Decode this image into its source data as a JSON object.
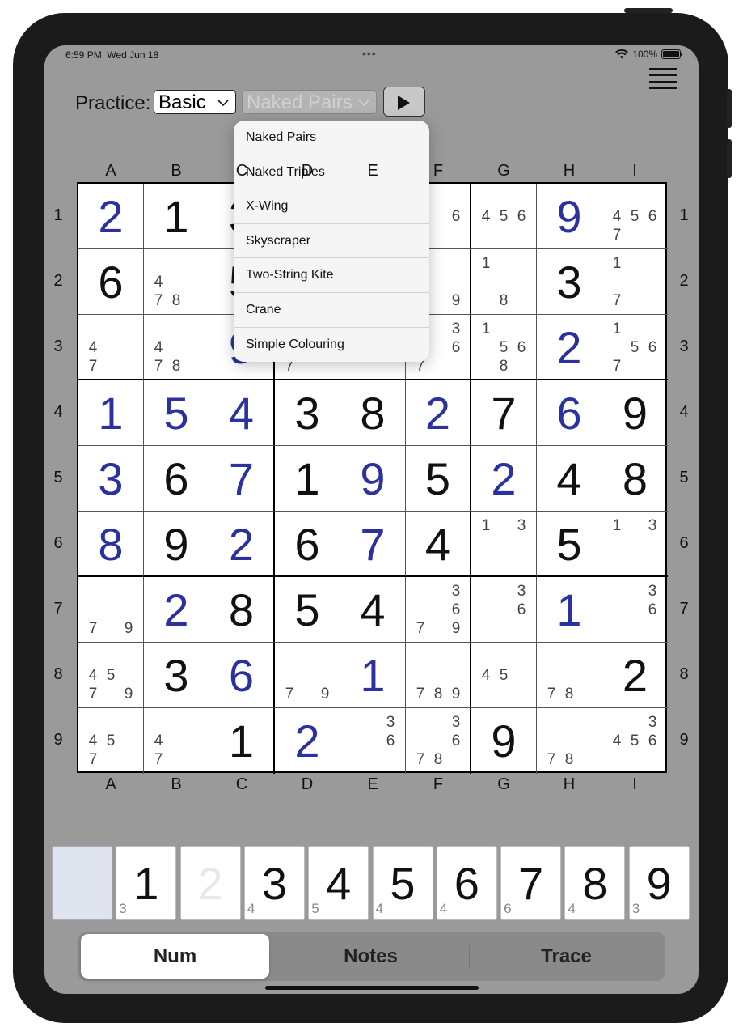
{
  "status_bar": {
    "time": "6:59 PM",
    "date": "Wed Jun 18",
    "battery": "100%",
    "dots": "•••"
  },
  "toolbar": {
    "practice_label": "Practice:",
    "level_select": "Basic",
    "technique_select": "Naked Pairs"
  },
  "technique_menu": [
    "Naked Pairs",
    "Naked Triples",
    "X-Wing",
    "Skyscraper",
    "Two-String Kite",
    "Crane",
    "Simple Colouring"
  ],
  "columns": [
    "A",
    "B",
    "C",
    "D",
    "E",
    "F",
    "G",
    "H",
    "I"
  ],
  "rows": [
    "1",
    "2",
    "3",
    "4",
    "5",
    "6",
    "7",
    "8",
    "9"
  ],
  "grid": [
    [
      {
        "v": "2",
        "s": "solved"
      },
      {
        "v": "1",
        "s": "given"
      },
      {
        "v": "3",
        "s": "given"
      },
      {
        "n": []
      },
      {
        "n": []
      },
      {
        "n": [
          6
        ]
      },
      {
        "n": [
          4,
          5,
          6
        ]
      },
      {
        "v": "9",
        "s": "solved"
      },
      {
        "n": [
          4,
          5,
          6,
          7
        ]
      }
    ],
    [
      {
        "v": "6",
        "s": "given"
      },
      {
        "n": [
          4,
          7,
          8
        ]
      },
      {
        "v": "5",
        "s": "given"
      },
      {
        "n": []
      },
      {
        "n": []
      },
      {
        "n": [
          9
        ]
      },
      {
        "n": [
          1,
          8
        ]
      },
      {
        "v": "3",
        "s": "given"
      },
      {
        "n": [
          1,
          7
        ]
      }
    ],
    [
      {
        "n": [
          4,
          7
        ]
      },
      {
        "n": [
          4,
          7,
          8
        ]
      },
      {
        "v": "9",
        "s": "solved"
      },
      {
        "n": [
          7
        ]
      },
      {
        "n": []
      },
      {
        "n": [
          3,
          6,
          7
        ]
      },
      {
        "n": [
          1,
          5,
          6,
          8
        ]
      },
      {
        "v": "2",
        "s": "solved"
      },
      {
        "n": [
          1,
          5,
          6,
          7
        ]
      }
    ],
    [
      {
        "v": "1",
        "s": "solved"
      },
      {
        "v": "5",
        "s": "solved"
      },
      {
        "v": "4",
        "s": "solved"
      },
      {
        "v": "3",
        "s": "given"
      },
      {
        "v": "8",
        "s": "given"
      },
      {
        "v": "2",
        "s": "solved"
      },
      {
        "v": "7",
        "s": "given"
      },
      {
        "v": "6",
        "s": "solved"
      },
      {
        "v": "9",
        "s": "given"
      }
    ],
    [
      {
        "v": "3",
        "s": "solved"
      },
      {
        "v": "6",
        "s": "given"
      },
      {
        "v": "7",
        "s": "solved"
      },
      {
        "v": "1",
        "s": "given"
      },
      {
        "v": "9",
        "s": "solved"
      },
      {
        "v": "5",
        "s": "given"
      },
      {
        "v": "2",
        "s": "solved"
      },
      {
        "v": "4",
        "s": "given"
      },
      {
        "v": "8",
        "s": "given"
      }
    ],
    [
      {
        "v": "8",
        "s": "solved"
      },
      {
        "v": "9",
        "s": "given"
      },
      {
        "v": "2",
        "s": "solved"
      },
      {
        "v": "6",
        "s": "given"
      },
      {
        "v": "7",
        "s": "solved"
      },
      {
        "v": "4",
        "s": "given"
      },
      {
        "n": [
          1,
          3
        ]
      },
      {
        "v": "5",
        "s": "given"
      },
      {
        "n": [
          1,
          3
        ]
      }
    ],
    [
      {
        "n": [
          7,
          9
        ]
      },
      {
        "v": "2",
        "s": "solved"
      },
      {
        "v": "8",
        "s": "given"
      },
      {
        "v": "5",
        "s": "given"
      },
      {
        "v": "4",
        "s": "given"
      },
      {
        "n": [
          3,
          6,
          7,
          9
        ]
      },
      {
        "n": [
          3,
          6
        ]
      },
      {
        "v": "1",
        "s": "solved"
      },
      {
        "n": [
          3,
          6
        ]
      }
    ],
    [
      {
        "n": [
          4,
          5,
          7,
          9
        ]
      },
      {
        "v": "3",
        "s": "given"
      },
      {
        "v": "6",
        "s": "solved"
      },
      {
        "n": [
          7,
          9
        ]
      },
      {
        "v": "1",
        "s": "solved"
      },
      {
        "n": [
          7,
          8,
          9
        ]
      },
      {
        "n": [
          4,
          5
        ]
      },
      {
        "n": [
          7,
          8
        ]
      },
      {
        "v": "2",
        "s": "given"
      }
    ],
    [
      {
        "n": [
          4,
          5,
          7
        ]
      },
      {
        "n": [
          4,
          7
        ]
      },
      {
        "v": "1",
        "s": "given"
      },
      {
        "v": "2",
        "s": "solved"
      },
      {
        "n": [
          3,
          6
        ]
      },
      {
        "n": [
          3,
          6,
          7,
          8
        ]
      },
      {
        "v": "9",
        "s": "given"
      },
      {
        "n": [
          7,
          8
        ]
      },
      {
        "n": [
          3,
          4,
          5,
          6
        ]
      }
    ]
  ],
  "numpad": [
    {
      "digit": "",
      "count": "",
      "state": "blank"
    },
    {
      "digit": "1",
      "count": "3",
      "state": "normal"
    },
    {
      "digit": "2",
      "count": "",
      "state": "done"
    },
    {
      "digit": "3",
      "count": "4",
      "state": "normal"
    },
    {
      "digit": "4",
      "count": "5",
      "state": "normal"
    },
    {
      "digit": "5",
      "count": "4",
      "state": "normal"
    },
    {
      "digit": "6",
      "count": "4",
      "state": "normal"
    },
    {
      "digit": "7",
      "count": "6",
      "state": "normal"
    },
    {
      "digit": "8",
      "count": "4",
      "state": "normal"
    },
    {
      "digit": "9",
      "count": "3",
      "state": "normal"
    }
  ],
  "modes": [
    {
      "label": "Num",
      "active": true
    },
    {
      "label": "Notes",
      "active": false
    },
    {
      "label": "Trace",
      "active": false
    }
  ]
}
